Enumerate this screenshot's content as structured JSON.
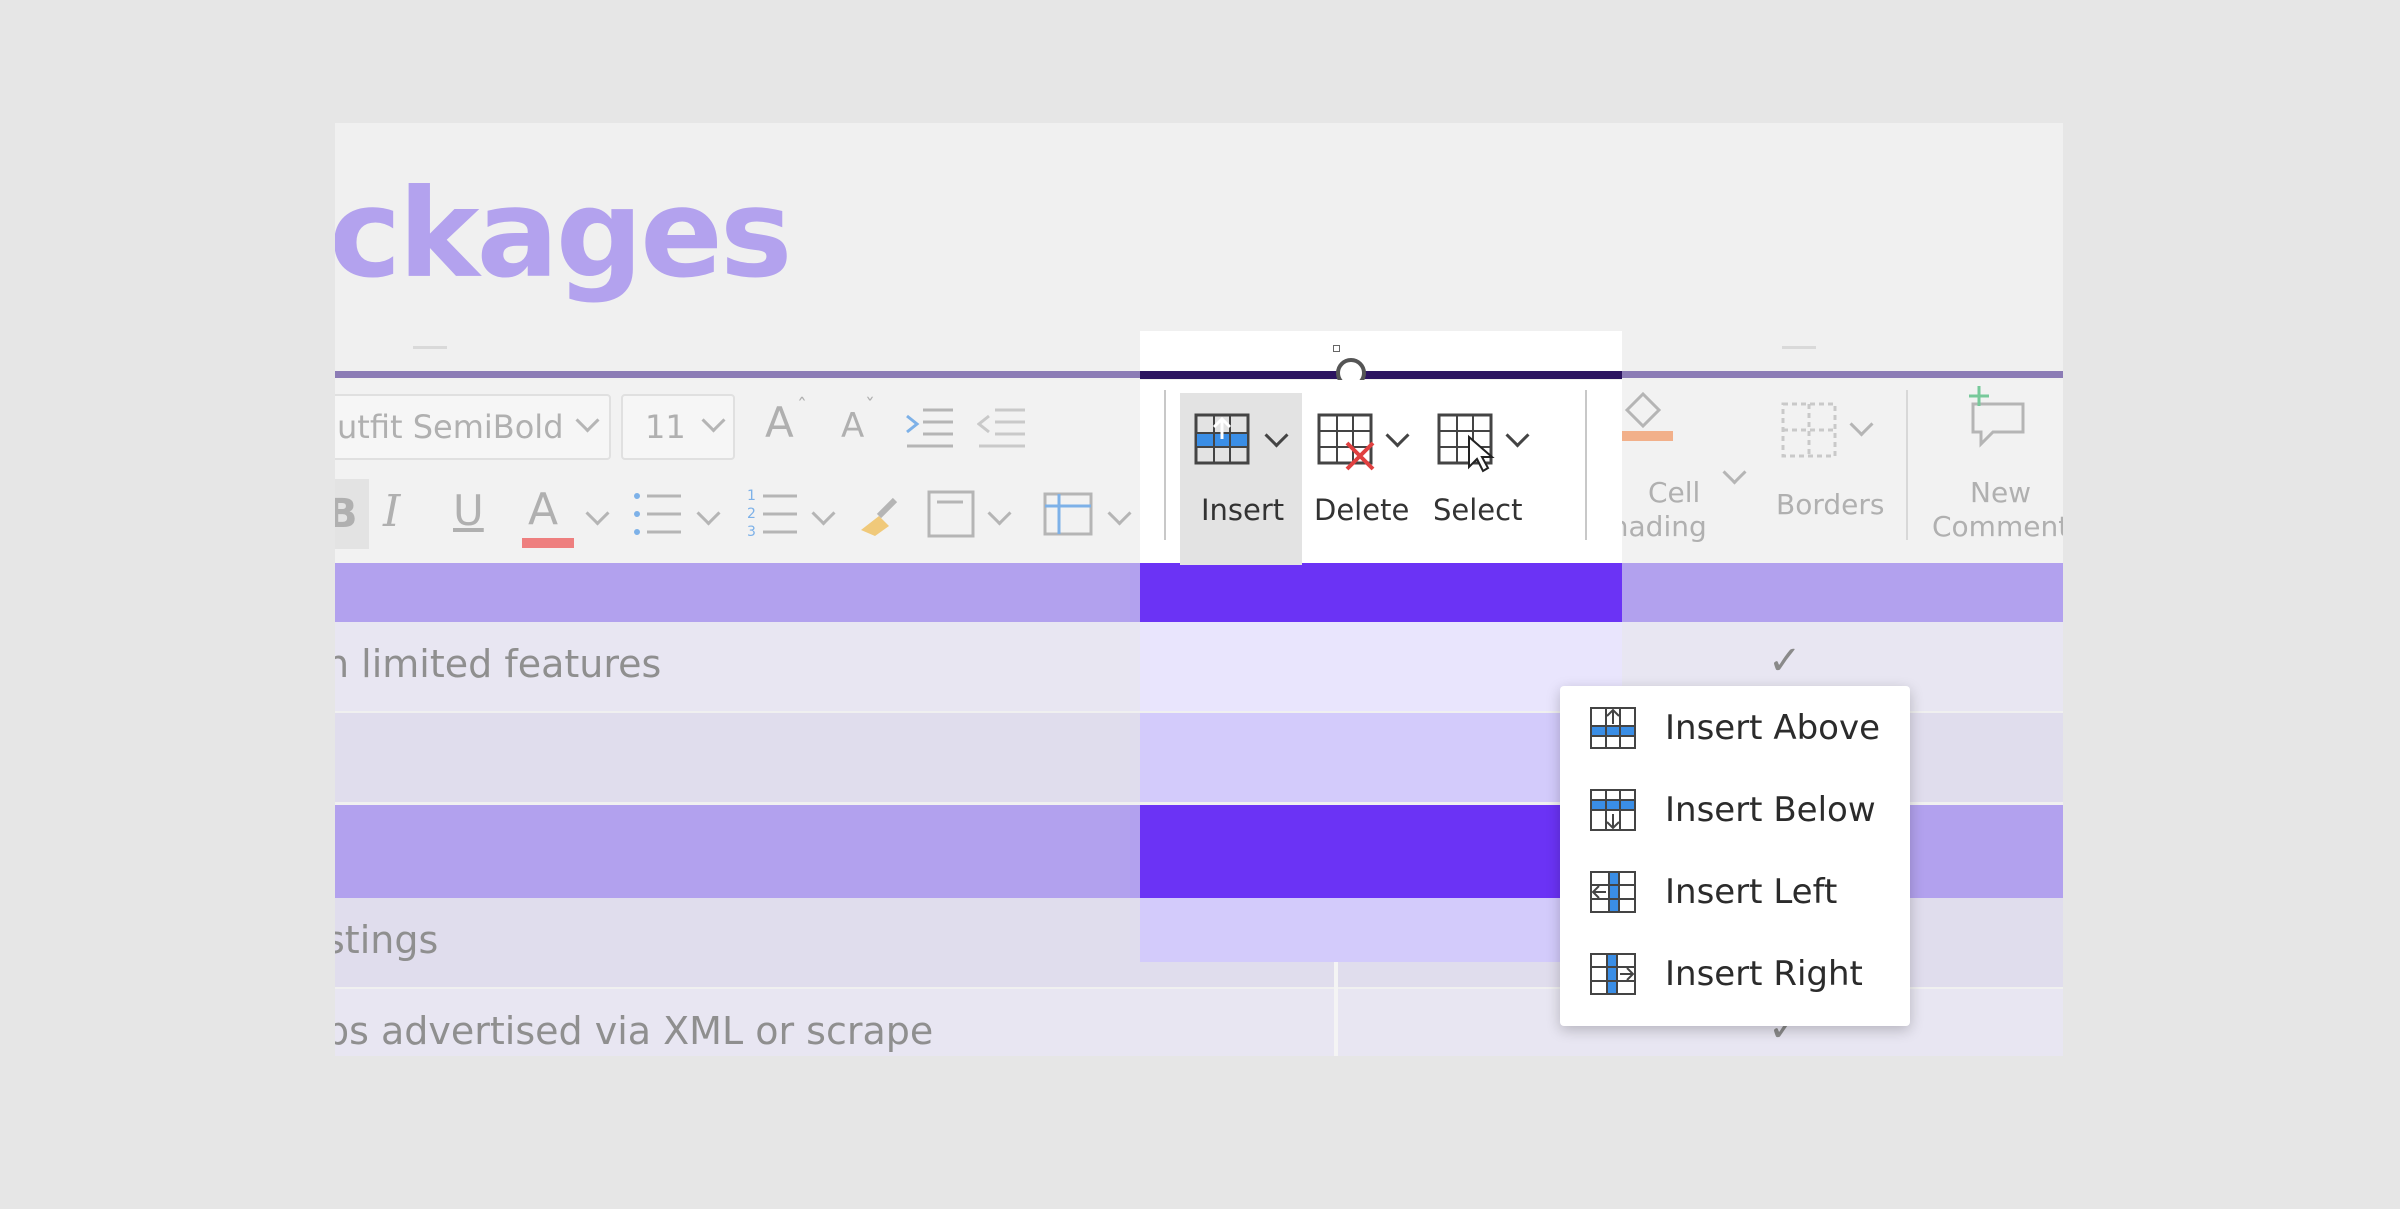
{
  "document": {
    "heading": "ckages",
    "rows": [
      {
        "text": "",
        "check": ""
      },
      {
        "text": "n limited features",
        "check": "✓"
      },
      {
        "text": "",
        "check": "✓"
      },
      {
        "text": "",
        "check": ""
      },
      {
        "text": "stings",
        "check": "✓"
      },
      {
        "text": "bs advertised via XML or scrape",
        "check": "✓"
      }
    ]
  },
  "ribbon": {
    "font_name": "utfit SemiBold",
    "font_size": "11",
    "grow_font": "A",
    "shrink_font": "A",
    "bold": "B",
    "italic": "I",
    "underline": "U",
    "font_color": "A",
    "table": {
      "insert_label": "Insert",
      "delete_label": "Delete",
      "select_label": "Select"
    },
    "cell_shading_line1": "Cell",
    "cell_shading_line2": "Shading",
    "borders_label": "Borders",
    "new_comment_line1": "New",
    "new_comment_line2": "Comment"
  },
  "insert_menu": {
    "items": [
      {
        "label": "Insert Above",
        "icon": "insert-above-icon"
      },
      {
        "label": "Insert Below",
        "icon": "insert-below-icon"
      },
      {
        "label": "Insert Left",
        "icon": "insert-left-icon"
      },
      {
        "label": "Insert Right",
        "icon": "insert-right-icon"
      }
    ]
  },
  "colors": {
    "heading": "#b3a2ee",
    "header_row": "#b2a1ee",
    "selected_header_cell": "#6b33f5",
    "selected_cell": "#d3cbfb",
    "accent_blue": "#3a8ee6"
  }
}
